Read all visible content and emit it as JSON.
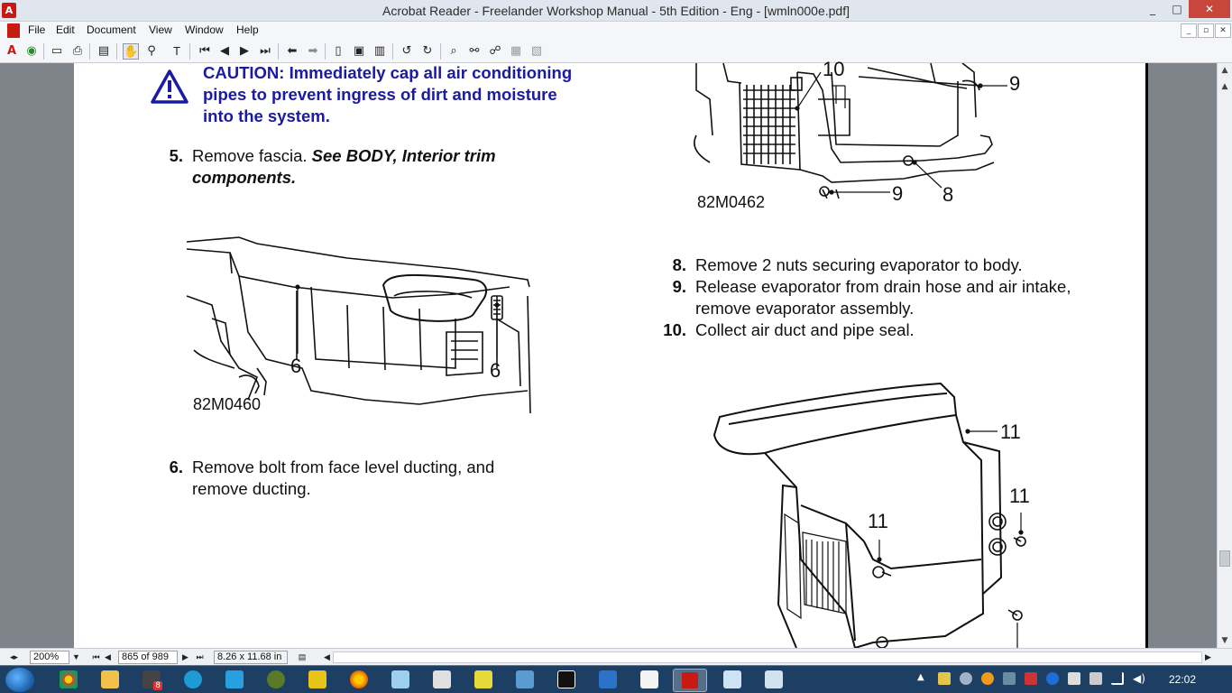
{
  "window": {
    "title": "Acrobat Reader - Freelander Workshop Manual - 5th Edition - Eng - [wmln000e.pdf]",
    "minimize": "_",
    "maximize": "□",
    "close": "✕"
  },
  "menu": [
    "File",
    "Edit",
    "Document",
    "View",
    "Window",
    "Help"
  ],
  "document": {
    "caution": "CAUTION: Immediately cap all air conditioning pipes to prevent ingress of dirt and moisture into the system.",
    "steps": [
      {
        "num": "5.",
        "text": "Remove fascia.",
        "ref": "See  BODY, Interior trim components."
      },
      {
        "num": "6.",
        "text": "Remove bolt from face level ducting, and remove ducting.",
        "ref": ""
      },
      {
        "num": "8.",
        "text": "Remove 2 nuts securing evaporator to body.",
        "ref": ""
      },
      {
        "num": "9.",
        "text": "Release evaporator from drain hose and air intake, remove evaporator assembly.",
        "ref": ""
      },
      {
        "num": "10.",
        "text": "Collect air duct and pipe seal.",
        "ref": ""
      }
    ],
    "figures": {
      "fig1": {
        "code": "82M0460",
        "callouts": [
          "6",
          "6"
        ]
      },
      "fig2": {
        "code": "82M0462",
        "callouts": [
          "10",
          "9",
          "9",
          "8"
        ]
      },
      "fig3": {
        "callouts": [
          "11",
          "11",
          "11"
        ]
      }
    }
  },
  "statusbar": {
    "zoom": "200%",
    "page": "865 of 989",
    "page_size": "8.26 x 11.68 in"
  },
  "taskbar": {
    "clock": "22:02",
    "badge": "8"
  },
  "colors": {
    "caution_blue": "#1a1aa5",
    "doc_background": "#7e8489",
    "taskbar": "#1c3f63"
  }
}
